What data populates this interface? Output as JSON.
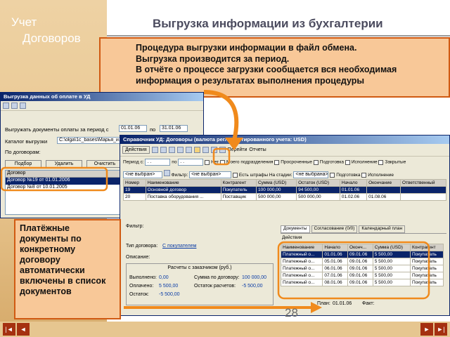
{
  "slide": {
    "logo_line1": "Учет",
    "logo_line2": "Договоров",
    "title": "Выгрузка информации из бухгалтерии",
    "page_number": "28",
    "info_lines": [
      "Процедура выгрузки информации в файл обмена.",
      "Выгрузка производится за период.",
      "В отчёте о процессе загрузки сообщается вся необходимая",
      "информация о результатах выполнения процедуры"
    ],
    "callout": "Платёжные документы по конкретному договору автоматически включены в список документов"
  },
  "export_window": {
    "title": "Выгрузка данных об оплате в УД",
    "period_label": "Выгружать документы оплаты за период с",
    "date_from": "01.01.06",
    "date_to_label": "по",
    "date_to": "31.01.06",
    "catalog_label": "Каталог выгрузки",
    "catalog_value": "C:\\olga\\1c_bases\\Марья_и...",
    "contracts_label": "По договорам:",
    "btn_select": "Подбор",
    "btn_delete": "Удалить",
    "btn_clear": "Очистить",
    "list_header": "Договор",
    "items": [
      "Договор №19 от 01.01.2006",
      "Договор №8 от 10.01.2005"
    ]
  },
  "contracts_window": {
    "title": "Справочник УД: Договоры (валюта регламентированного учета: USD)",
    "toolbar": {
      "actions": "Действия",
      "goto": "Перейти",
      "reports": "Отчеты"
    },
    "filter": {
      "period_label": "Период с:",
      "date_from": ". .",
      "to_label": "по",
      "date_to": ". .",
      "no_label": "Нет",
      "other_units": "Моего подразделения",
      "overdue": "Просроченные",
      "preparation": "Подготовка",
      "execution": "Исполнение",
      "closed": "Закрытые",
      "not_selected": "<не выбран>",
      "filter_label": "Фильтр:",
      "fines": "Есть штрафы",
      "stage": "На стадии:",
      "not_selected2": "<не выбрана>",
      "prep2": "Подготовка",
      "exec2": "Исполнение"
    },
    "table": {
      "headers": [
        "Номер",
        "Наименование",
        "Контрагент",
        "Сумма (USD)",
        "Остаток (USD)",
        "Начало",
        "Окончание",
        "Ответственный"
      ],
      "rows": [
        [
          "19",
          "Основной договор",
          "Покупатель",
          "100 000,00",
          "94 500,00",
          "01.01.06",
          "",
          ""
        ],
        [
          "20",
          "Поставка оборудования ...",
          "Поставщик",
          "500 000,00",
          "500 000,00",
          "01.02.06",
          "01.08.06",
          ""
        ]
      ]
    },
    "lower": {
      "filter_label": "Фильтр:",
      "type_label": "Тип договора:",
      "type_value": "С покупателем",
      "desc_label": "Описание:",
      "group": "Расчеты с заказчиком (руб.)",
      "done_label": "Выполнено:",
      "done": "0,00",
      "paid_label": "Оплачено:",
      "paid": "5 500,00",
      "balance_label": "Остаток:",
      "balance": "-5 500,00",
      "contract_sum_label": "Сумма по договору:",
      "contract_sum": "100 000,00",
      "remainder_label": "Остаток расчетов:",
      "remainder": "-5 500,00"
    },
    "tabs": [
      "Документы",
      "Согласование (0/0)",
      "Календарный план"
    ],
    "docs": {
      "actions": "Действия",
      "headers": [
        "Наименование",
        "Начало",
        "Оконч...",
        "Сумма (USD)",
        "Контрагент"
      ],
      "rows": [
        [
          "Платежный о...",
          "01.01.06",
          "09.01.06",
          "5 500,00",
          "Покупатель"
        ],
        [
          "Платежный о...",
          "05.01.06",
          "09.01.06",
          "5 500,00",
          "Покупатель"
        ],
        [
          "Платежный о...",
          "06.01.06",
          "09.01.06",
          "5 500,00",
          "Покупатель"
        ],
        [
          "Платежный о...",
          "07.01.06",
          "09.01.06",
          "5 500,00",
          "Покупатель"
        ],
        [
          "Платежный о...",
          "08.01.06",
          "09.01.06",
          "5 500,00",
          "Покупатель"
        ]
      ],
      "plan_label": "План:",
      "plan_value": "01.01.06",
      "fact_label": "Факт:"
    }
  },
  "nav": {
    "first": "|◄",
    "prev": "◄",
    "next": "►",
    "last": "►|"
  },
  "colors": {
    "accent": "#d05a12",
    "callout_bg": "#f8c898"
  }
}
